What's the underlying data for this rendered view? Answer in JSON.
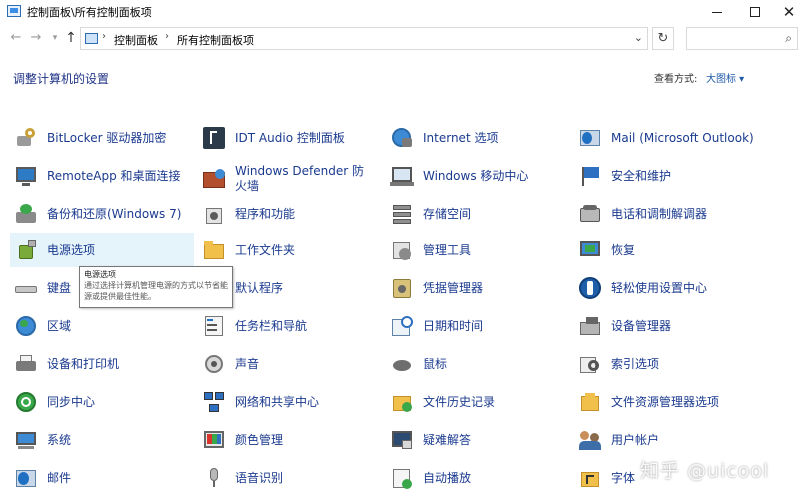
{
  "window": {
    "title": "控制面板\\所有控制面板项"
  },
  "nav": {
    "breadcrumbs": [
      "控制面板",
      "所有控制面板项"
    ],
    "back_icon": "back-arrow-icon",
    "forward_icon": "forward-arrow-icon",
    "up_icon": "up-arrow-icon",
    "search_placeholder": ""
  },
  "header": {
    "title": "调整计算机的设置",
    "view_by_label": "查看方式:",
    "view_by_value": "大图标 ▾"
  },
  "items": [
    {
      "label": "BitLocker 驱动器加密",
      "icon": "bitlocker-icon"
    },
    {
      "label": "IDT Audio 控制面板",
      "icon": "idt-audio-icon"
    },
    {
      "label": "Internet 选项",
      "icon": "internet-options-icon"
    },
    {
      "label": "Mail (Microsoft Outlook)",
      "icon": "mail-outlook-icon"
    },
    {
      "label": "RemoteApp 和桌面连接",
      "icon": "remoteapp-icon"
    },
    {
      "label": "Windows Defender 防火墙",
      "icon": "firewall-icon"
    },
    {
      "label": "Windows 移动中心",
      "icon": "mobility-center-icon"
    },
    {
      "label": "安全和维护",
      "icon": "security-flag-icon"
    },
    {
      "label": "备份和还原(Windows 7)",
      "icon": "backup-restore-icon"
    },
    {
      "label": "程序和功能",
      "icon": "programs-features-icon"
    },
    {
      "label": "存储空间",
      "icon": "storage-spaces-icon"
    },
    {
      "label": "电话和调制解调器",
      "icon": "phone-modem-icon"
    },
    {
      "label": "电源选项",
      "icon": "power-options-icon"
    },
    {
      "label": "工作文件夹",
      "icon": "work-folders-icon"
    },
    {
      "label": "管理工具",
      "icon": "admin-tools-icon"
    },
    {
      "label": "恢复",
      "icon": "recovery-icon"
    },
    {
      "label": "键盘",
      "icon": "keyboard-icon"
    },
    {
      "label": "默认程序",
      "icon": "default-programs-icon"
    },
    {
      "label": "凭据管理器",
      "icon": "credential-manager-icon"
    },
    {
      "label": "轻松使用设置中心",
      "icon": "ease-of-access-icon"
    },
    {
      "label": "区域",
      "icon": "region-icon"
    },
    {
      "label": "任务栏和导航",
      "icon": "taskbar-icon"
    },
    {
      "label": "日期和时间",
      "icon": "date-time-icon"
    },
    {
      "label": "设备管理器",
      "icon": "device-manager-icon"
    },
    {
      "label": "设备和打印机",
      "icon": "devices-printers-icon"
    },
    {
      "label": "声音",
      "icon": "sound-icon"
    },
    {
      "label": "鼠标",
      "icon": "mouse-icon"
    },
    {
      "label": "索引选项",
      "icon": "indexing-icon"
    },
    {
      "label": "同步中心",
      "icon": "sync-center-icon"
    },
    {
      "label": "网络和共享中心",
      "icon": "network-sharing-icon"
    },
    {
      "label": "文件历史记录",
      "icon": "file-history-icon"
    },
    {
      "label": "文件资源管理器选项",
      "icon": "explorer-options-icon"
    },
    {
      "label": "系统",
      "icon": "system-icon"
    },
    {
      "label": "颜色管理",
      "icon": "color-management-icon"
    },
    {
      "label": "疑难解答",
      "icon": "troubleshooting-icon"
    },
    {
      "label": "用户帐户",
      "icon": "user-accounts-icon"
    },
    {
      "label": "邮件",
      "icon": "mail-icon"
    },
    {
      "label": "语音识别",
      "icon": "speech-recognition-icon"
    },
    {
      "label": "自动播放",
      "icon": "autoplay-icon"
    },
    {
      "label": "字体",
      "icon": "fonts-icon"
    }
  ],
  "tooltip": {
    "title": "电源选项",
    "body": "通过选择计算机管理电源的方式以节省能源或提供最佳性能。"
  },
  "watermark": "知乎 @uicool",
  "colors": {
    "link": "#1a3a8f",
    "header": "#1e3287",
    "hover": "#e5f3fb"
  }
}
